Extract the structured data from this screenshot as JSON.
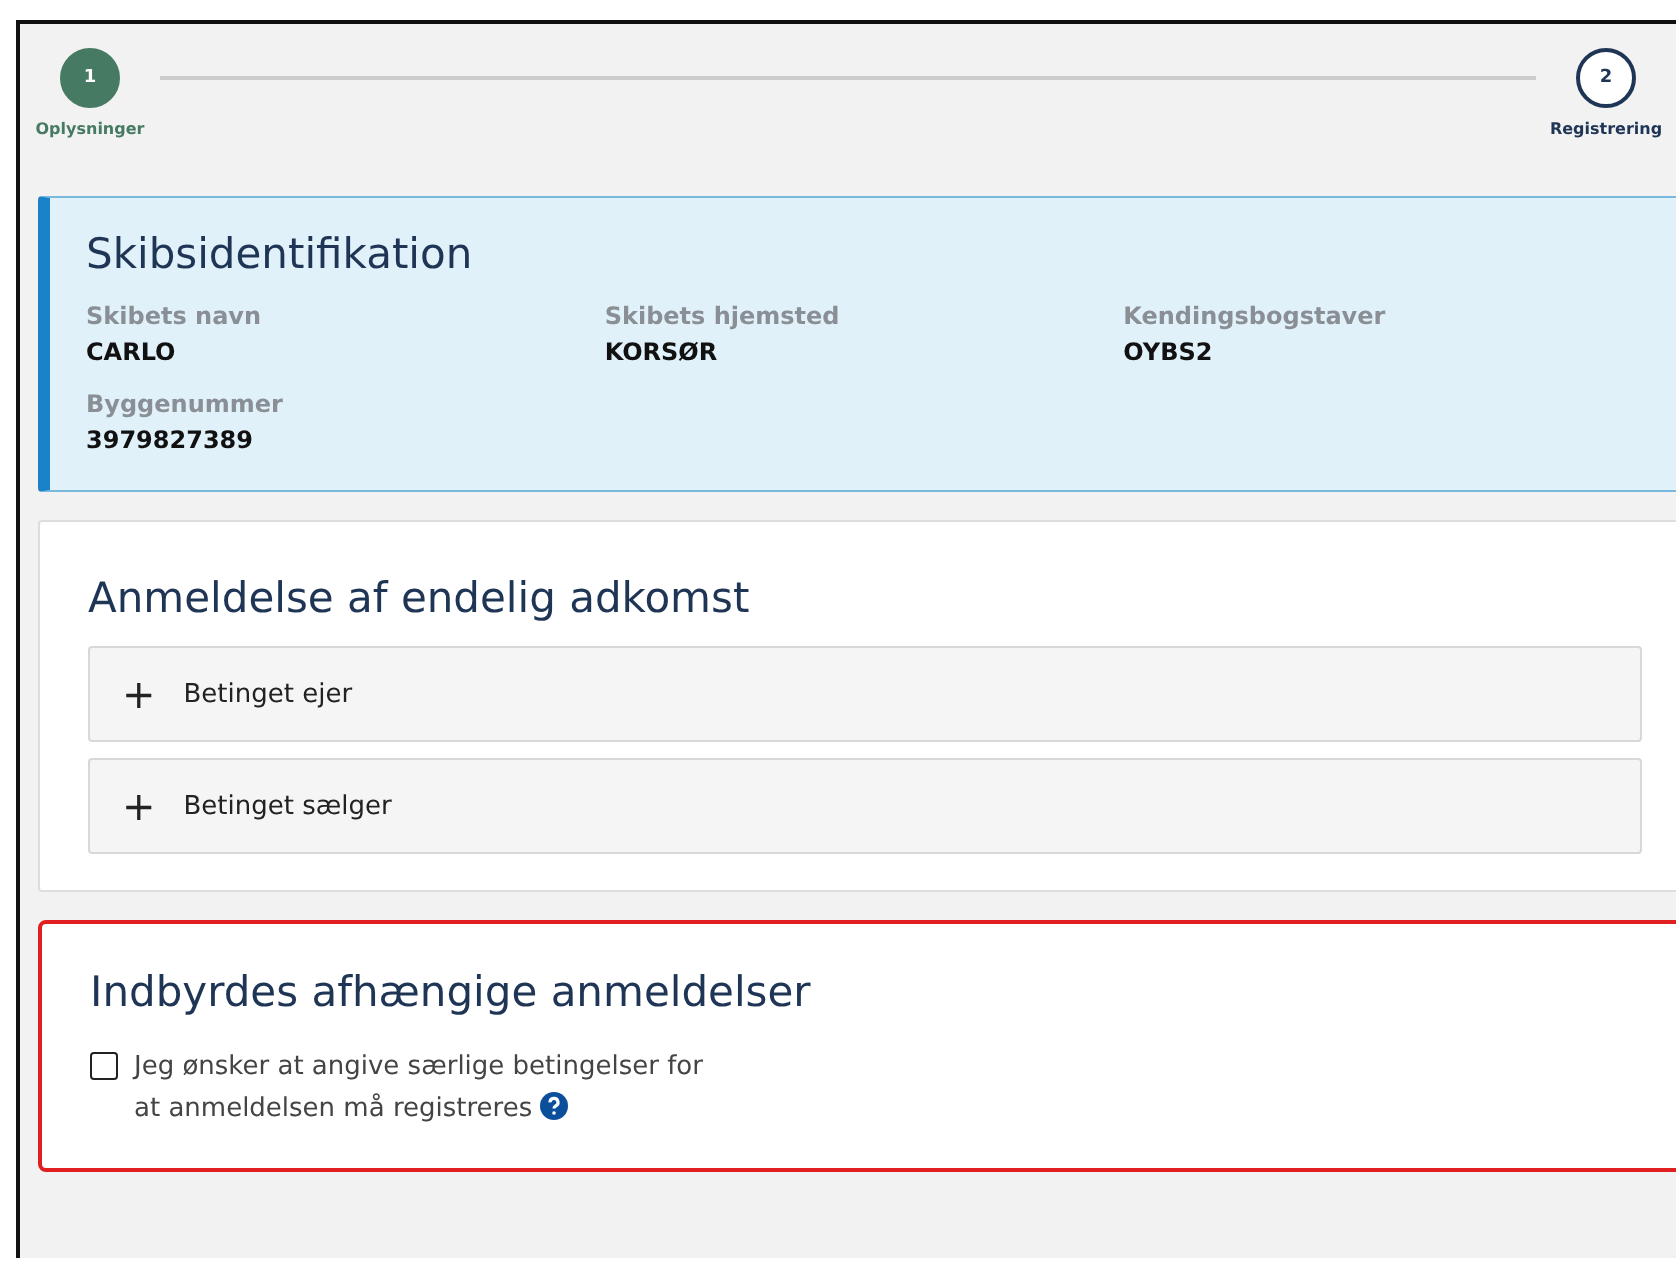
{
  "stepper": [
    {
      "number": "1",
      "label": "Oplysninger",
      "selected": true
    },
    {
      "number": "2",
      "label": "Registrering",
      "selected": false
    }
  ],
  "ship_identification": {
    "title": "Skibsidentifikation",
    "fields": [
      {
        "label": "Skibets navn",
        "value": "CARLO"
      },
      {
        "label": "Skibets hjemsted",
        "value": "KORSØR"
      },
      {
        "label": "Kendingsbogstaver",
        "value": "OYBS2"
      },
      {
        "label": "Byggenummer",
        "value": "3979827389"
      }
    ]
  },
  "title_section": {
    "title": "Anmeldelse af endelig adkomst",
    "items": [
      {
        "icon": "+",
        "label": "Betinget ejer",
        "expanded": false
      },
      {
        "icon": "+",
        "label": "Betinget sælger",
        "expanded": false
      }
    ]
  },
  "dependent_section": {
    "title": "Indbyrdes afhængige anmeldelser",
    "highlighted": true,
    "checkbox": {
      "label": "Jeg ønsker at angive særlige betingelser for at anmeldelsen må registreres",
      "checked": false
    }
  }
}
